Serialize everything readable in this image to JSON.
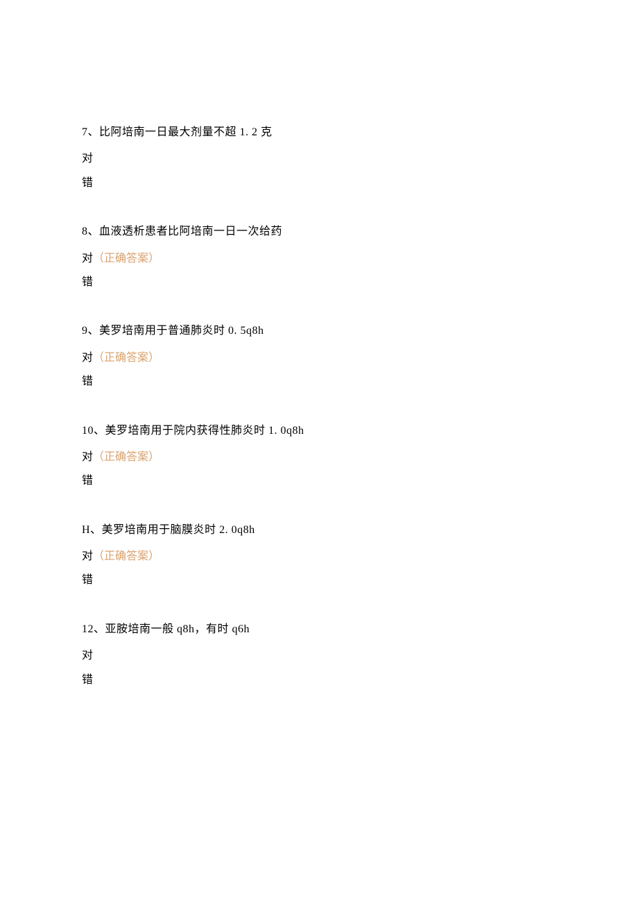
{
  "questions": [
    {
      "number": "7、",
      "text": "比阿培南一日最大剂量不超 1. 2 克",
      "opt1": "对",
      "opt1_correct": "",
      "opt2": "错"
    },
    {
      "number": "8、",
      "text": "血液透析患者比阿培南一日一次给药",
      "opt1": "对",
      "opt1_correct": "（正确答案）",
      "opt2": "错"
    },
    {
      "number": "9、",
      "text": "美罗培南用于普通肺炎时 0. 5q8h",
      "opt1": "对",
      "opt1_correct": "（正确答案）",
      "opt2": "错"
    },
    {
      "number": "10、",
      "text": "美罗培南用于院内获得性肺炎时 1. 0q8h",
      "opt1": "对",
      "opt1_correct": "（正确答案）",
      "opt2": "错"
    },
    {
      "number": "H、",
      "text": "美罗培南用于脑膜炎时 2. 0q8h",
      "opt1": "对",
      "opt1_correct": "（正确答案）",
      "opt2": "错"
    },
    {
      "number": "12、",
      "text": "亚胺培南一般 q8h，有时 q6h",
      "opt1": "对",
      "opt1_correct": "",
      "opt2": "错"
    }
  ]
}
